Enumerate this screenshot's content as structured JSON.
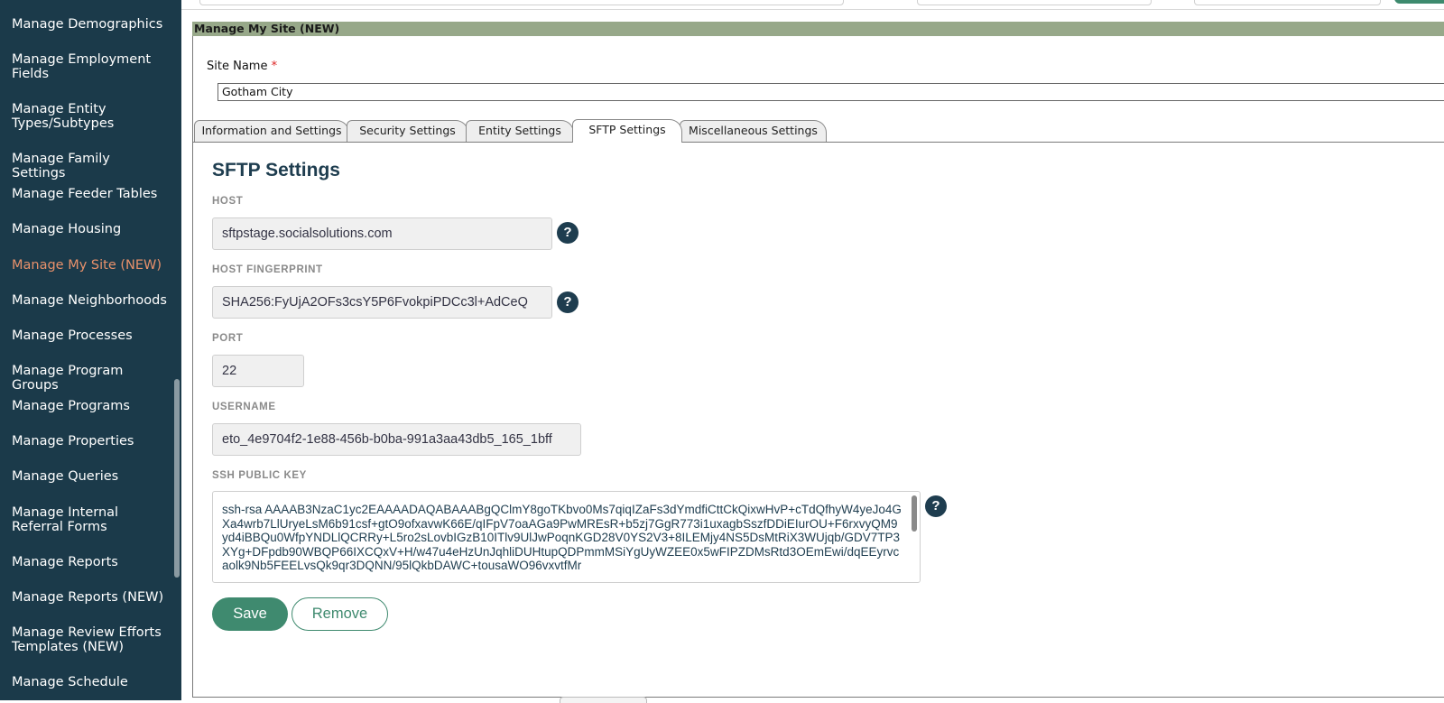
{
  "sidebar": {
    "items": [
      {
        "label": "Manage Demographics"
      },
      {
        "label": "Manage Employment Fields"
      },
      {
        "label": "Manage Entity Types/Subtypes"
      },
      {
        "label": "Manage Family Settings"
      },
      {
        "label": "Manage Feeder Tables"
      },
      {
        "label": "Manage Housing"
      },
      {
        "label": "Manage My Site (NEW)",
        "active": true
      },
      {
        "label": "Manage Neighborhoods"
      },
      {
        "label": "Manage Processes"
      },
      {
        "label": "Manage Program Groups"
      },
      {
        "label": "Manage Programs"
      },
      {
        "label": "Manage Properties"
      },
      {
        "label": "Manage Queries"
      },
      {
        "label": "Manage Internal Referral Forms"
      },
      {
        "label": "Manage Reports"
      },
      {
        "label": "Manage Reports (NEW)"
      },
      {
        "label": "Manage Review Efforts Templates (NEW)"
      },
      {
        "label": "Manage Schedule"
      }
    ]
  },
  "panel": {
    "title": "Manage My Site (NEW)",
    "site_name_label": "Site Name",
    "required_marker": "*",
    "site_name_value": "Gotham City"
  },
  "tabs": [
    {
      "label": "Information and Settings"
    },
    {
      "label": "Security Settings"
    },
    {
      "label": "Entity Settings"
    },
    {
      "label": "SFTP Settings",
      "active": true
    },
    {
      "label": "Miscellaneous Settings"
    }
  ],
  "sftp": {
    "title": "SFTP Settings",
    "host_label": "HOST",
    "host_value": "sftpstage.socialsolutions.com",
    "fingerprint_label": "HOST FINGERPRINT",
    "fingerprint_value": "SHA256:FyUjA2OFs3csY5P6FvokpiPDCc3l+AdCeQ",
    "port_label": "PORT",
    "port_value": "22",
    "username_label": "USERNAME",
    "username_value": "eto_4e9704f2-1e88-456b-b0ba-991a3aa43db5_165_1bff",
    "ssh_label": "SSH PUBLIC KEY",
    "ssh_value": "ssh-rsa AAAAB3NzaC1yc2EAAAADAQABAAABgQClmY8goTKbvo0Ms7qiqIZaFs3dYmdfiCttCkQixwHvP+cTdQfhyW4yeJo4GXa4wrb7LlUryeLsM6b91csf+gtO9ofxavwK66E/qIFpV7oaAGa9PwMREsR+b5zj7GgR773i1uxagbSszfDDiEIurOU+F6rxvyQM9yd4iBBQu0WfpYNDLlQCRRy+L5ro2sLovbIGzB10ITlv9UlJwPoqnKGD28V0YS2V3+8ILEMjy4NS5DsMtRiX3WUjqb/GDV7TP3XYg+DFpdb90WBQP66IXCQxV+H/w47u4eHzUnJqhliDUHtupQDPmmMSiYgUyWZEE0x5wFIPZDMsRtd3OEmEwi/dqEEyrvcaolk9Nb5FEELvsQk9qr3DQNN/95lQkbDAWC+tousaWO96vxvtfMr",
    "help_glyph": "?"
  },
  "actions": {
    "save_label": "Save",
    "remove_label": "Remove"
  },
  "colors": {
    "sidebar_bg": "#1b3a4a",
    "active_item": "#e8916b",
    "panel_header": "#97a889",
    "accent": "#3f8a6f",
    "heading": "#1e3d4f"
  }
}
